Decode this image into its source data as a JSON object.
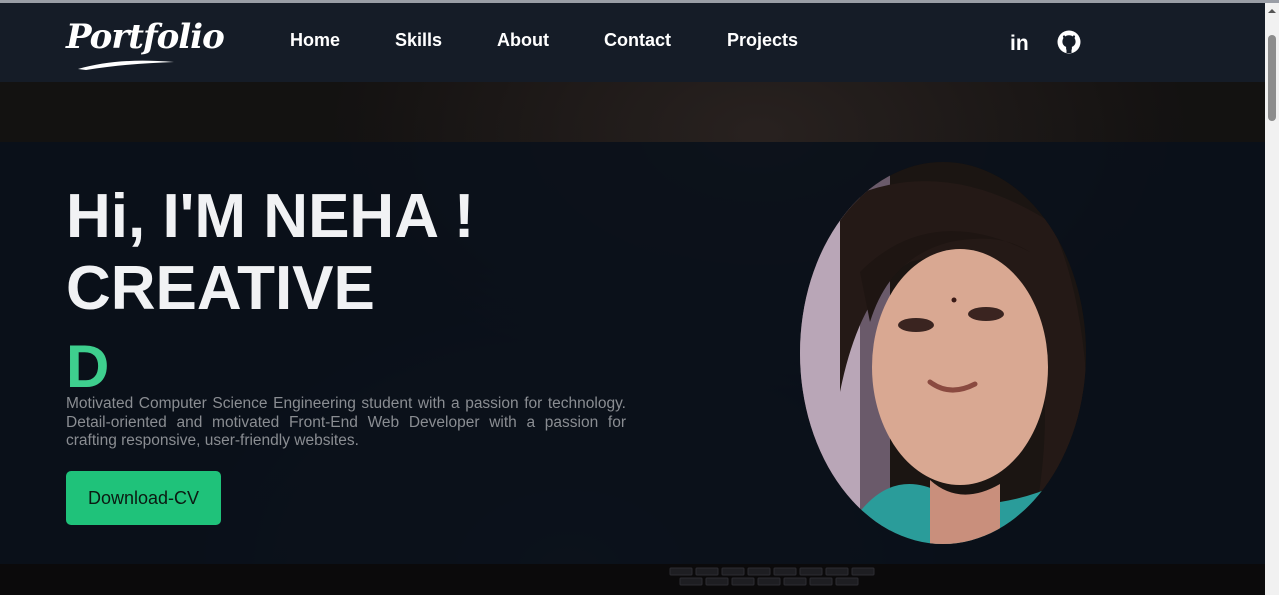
{
  "logo": {
    "text": "Portfolio"
  },
  "nav": {
    "items": [
      {
        "label": "Home"
      },
      {
        "label": "Skills"
      },
      {
        "label": "About"
      },
      {
        "label": "Contact"
      },
      {
        "label": "Projects"
      }
    ],
    "social": [
      {
        "icon": "linkedin-icon",
        "glyph": "in"
      },
      {
        "icon": "github-icon"
      }
    ]
  },
  "hero": {
    "line1": "Hi, I'M NEHA !",
    "line2": "CREATIVE",
    "typed_text": "D",
    "description": "Motivated Computer Science Engineering student with a passion for technology. Detail-oriented and motivated Front-End Web Developer with a passion for crafting responsive, user-friendly websites.",
    "button_label": "Download-CV"
  },
  "colors": {
    "navbar": "#151c27",
    "accent": "#3ecf8e",
    "button": "#1fc27a",
    "hero_panel": "#0a101a"
  }
}
